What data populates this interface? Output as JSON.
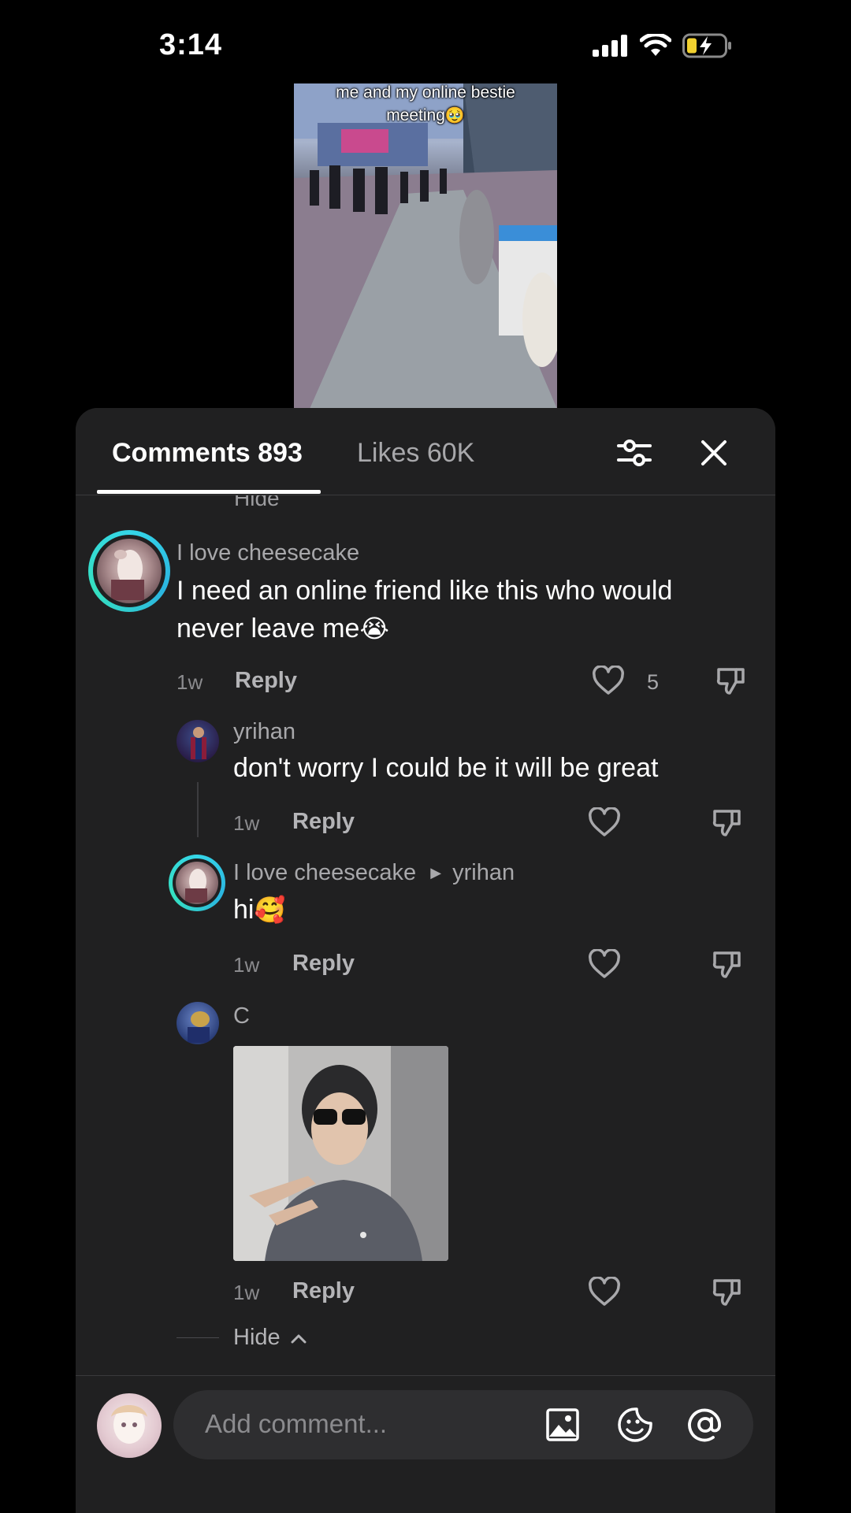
{
  "status_bar": {
    "time": "3:14"
  },
  "video": {
    "caption_line1": "me and my online bestie",
    "caption_line2": "meeting",
    "caption_emoji": "🥹"
  },
  "panel": {
    "tabs": [
      {
        "label": "Comments 893"
      },
      {
        "label": "Likes 60K"
      }
    ],
    "hide_top_label": "Hide"
  },
  "comments": [
    {
      "username": "I love cheesecake",
      "text_line1": "I need an online friend like this who would",
      "text_line2": "never leave me",
      "emoji": "😭",
      "time": "1w",
      "reply_label": "Reply",
      "likes": "5"
    },
    {
      "username": "yrihan",
      "text": "don't worry I could be it will be great",
      "time": "1w",
      "reply_label": "Reply"
    },
    {
      "username": "I love cheesecake",
      "reply_to": "yrihan",
      "text": "hi",
      "emoji": "🥰",
      "time": "1w",
      "reply_label": "Reply"
    },
    {
      "username": "C",
      "time": "1w",
      "reply_label": "Reply"
    }
  ],
  "hide_bottom_label": "Hide",
  "composer": {
    "placeholder": "Add comment..."
  },
  "icons": [
    "signal-icon",
    "wifi-icon",
    "battery-charging-icon",
    "filter-icon",
    "close-icon",
    "heart-icon",
    "dislike-icon",
    "image-icon",
    "sticker-icon",
    "at-icon"
  ],
  "colors": {
    "panel_bg": "#202021",
    "ring_accent": "#35d6e8",
    "text_muted": "#a8a8ab"
  }
}
